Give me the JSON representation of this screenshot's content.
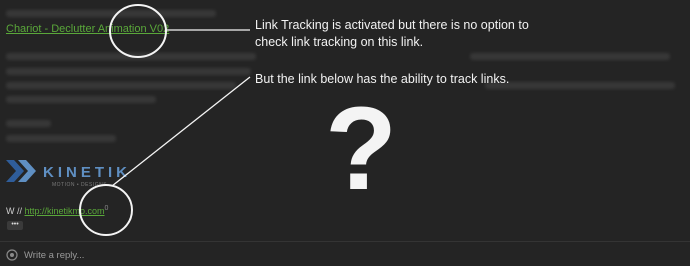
{
  "post": {
    "link_text": "Chariot - Declutter Animation V02",
    "signature_web_prefix": "W // ",
    "signature_url": "http://kinetikmo.com",
    "signature_url_count": "0",
    "more_button": "•••"
  },
  "logo": {
    "word": "KINETIK",
    "tagline": "MOTION • DESIGNS"
  },
  "annotations": {
    "note_line_1": "Link Tracking is activated but there is no option to",
    "note_line_2": "check link tracking on this link.",
    "note_line_3": "But the link below has the ability to track links.",
    "question_mark": "?"
  },
  "composer": {
    "placeholder": "Write a reply...",
    "icon": "reply-bubble-icon"
  },
  "colors": {
    "background": "#242424",
    "link": "#5aa83a",
    "logo_blue": "#5f8fc2",
    "annotation": "#f2f2f2"
  }
}
